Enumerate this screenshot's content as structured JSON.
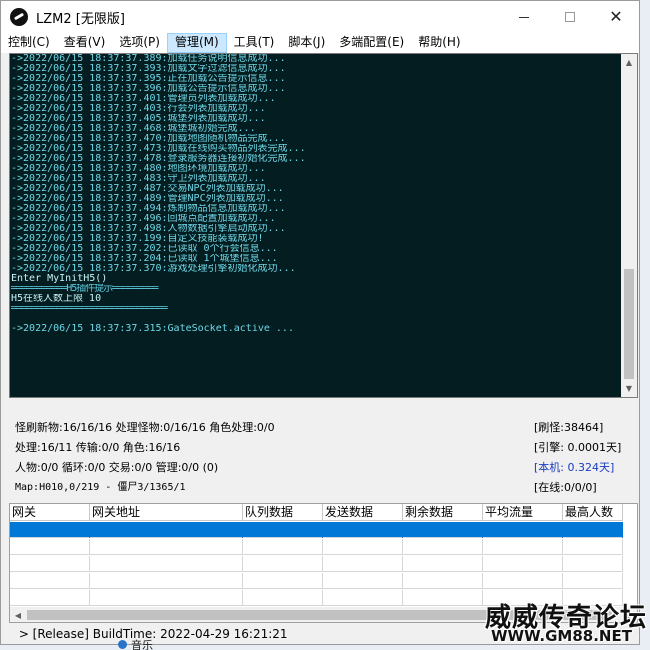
{
  "window": {
    "title": "LZM2 [无限版]"
  },
  "icons": {
    "app": "app-logo-icon",
    "minimize": "minimize-icon",
    "maximize": "maximize-icon",
    "close": "close-icon",
    "scroll_up": "chevron-up-icon",
    "scroll_down": "chevron-down-icon",
    "scroll_left": "chevron-left-icon",
    "scroll_right": "chevron-right-icon"
  },
  "menu": [
    {
      "label": "控制(C)"
    },
    {
      "label": "查看(V)"
    },
    {
      "label": "选项(P)"
    },
    {
      "label": "管理(M)",
      "active": true
    },
    {
      "label": "工具(T)"
    },
    {
      "label": "脚本(J)"
    },
    {
      "label": "多端配置(E)"
    },
    {
      "label": "帮助(H)"
    }
  ],
  "console": {
    "lines": [
      {
        "text": "->2022/06/15 18:37:37.389:加载任务说明信息成功...",
        "kind": "log"
      },
      {
        "text": "->2022/06/15 18:37:37.393:加载文字过滤信息成功...",
        "kind": "log"
      },
      {
        "text": "->2022/06/15 18:37:37.395:正在加载公告提示信息...",
        "kind": "log"
      },
      {
        "text": "->2022/06/15 18:37:37.396:加载公告提示信息成功...",
        "kind": "log"
      },
      {
        "text": "->2022/06/15 18:37:37.401:管理员列表加载成功...",
        "kind": "log"
      },
      {
        "text": "->2022/06/15 18:37:37.403:行会列表加载成功...",
        "kind": "log"
      },
      {
        "text": "->2022/06/15 18:37:37.405:城堡列表加载成功...",
        "kind": "log"
      },
      {
        "text": "->2022/06/15 18:37:37.468:城堡城初始完成...",
        "kind": "log"
      },
      {
        "text": "->2022/06/15 18:37:37.470:加载地图随机物品完成...",
        "kind": "log"
      },
      {
        "text": "->2022/06/15 18:37:37.473:加载在线购买物品列表完成...",
        "kind": "log"
      },
      {
        "text": "->2022/06/15 18:37:37.478:登录服务器连接初始化完成...",
        "kind": "log"
      },
      {
        "text": "->2022/06/15 18:37:37.480:地图环境加载成功...",
        "kind": "log"
      },
      {
        "text": "->2022/06/15 18:37:37.483:守卫列表加载成功...",
        "kind": "log"
      },
      {
        "text": "->2022/06/15 18:37:37.487:交易NPC列表加载成功...",
        "kind": "log"
      },
      {
        "text": "->2022/06/15 18:37:37.489:管理NPC列表加载成功...",
        "kind": "log"
      },
      {
        "text": "->2022/06/15 18:37:37.494:炼制物品信息加载成功...",
        "kind": "log"
      },
      {
        "text": "->2022/06/15 18:37:37.496:回城点配置加载成功...",
        "kind": "log"
      },
      {
        "text": "->2022/06/15 18:37:37.498:人物数据引擎启动成功...",
        "kind": "log"
      },
      {
        "text": "->2022/06/15 18:37:37.199:自定义技能装载成功!",
        "kind": "log"
      },
      {
        "text": "->2022/06/15 18:37:37.202:已读取 0个行会信息...",
        "kind": "log"
      },
      {
        "text": "->2022/06/15 18:37:37.204:已读取 1个城堡信息...",
        "kind": "log"
      },
      {
        "text": "->2022/06/15 18:37:37.370:游戏处理引擎初始化成功...",
        "kind": "log"
      },
      {
        "text": "Enter MyInitH5()",
        "kind": "plain"
      },
      {
        "text": "═══════════H5插件提示═════════",
        "kind": "rule"
      },
      {
        "text": "H5在线人数上限 10",
        "kind": "plain"
      },
      {
        "text": "═══════════════════════════════",
        "kind": "rule"
      },
      {
        "text": "",
        "kind": "gap"
      },
      {
        "text": "->2022/06/15 18:37:37.315:GateSocket.active ...",
        "kind": "log"
      }
    ]
  },
  "stats": {
    "rows": [
      "怪刷新物:16/16/16 处理怪物:0/16/16 角色处理:0/0",
      "处理:16/11 传输:0/0 角色:16/16",
      "人物:0/0 循环:0/0 交易:0/0 管理:0/0 (0)",
      "Map:H010,0/219 - 僵尸3/1365/1"
    ],
    "right": [
      {
        "text": "[刷怪:38464]",
        "color": "#000000"
      },
      {
        "text": "[引擎: 0.0001天]",
        "color": "#000000"
      },
      {
        "text": "[本机: 0.324天]",
        "color": "#1a3cbf"
      },
      {
        "text": "[在线:0/0/0]",
        "color": "#000000"
      }
    ]
  },
  "grid": {
    "columns": [
      "网关",
      "网关地址",
      "队列数据",
      "发送数据",
      "剩余数据",
      "平均流量",
      "最高人数"
    ],
    "selection_color": "#0078d7"
  },
  "status": {
    "text": " > [Release] BuildTime: 2022-04-29 16:21:21"
  },
  "watermark": {
    "title": "威威传奇论坛",
    "url": "WWW.GM88.NET"
  },
  "background": {
    "label": "音乐"
  }
}
